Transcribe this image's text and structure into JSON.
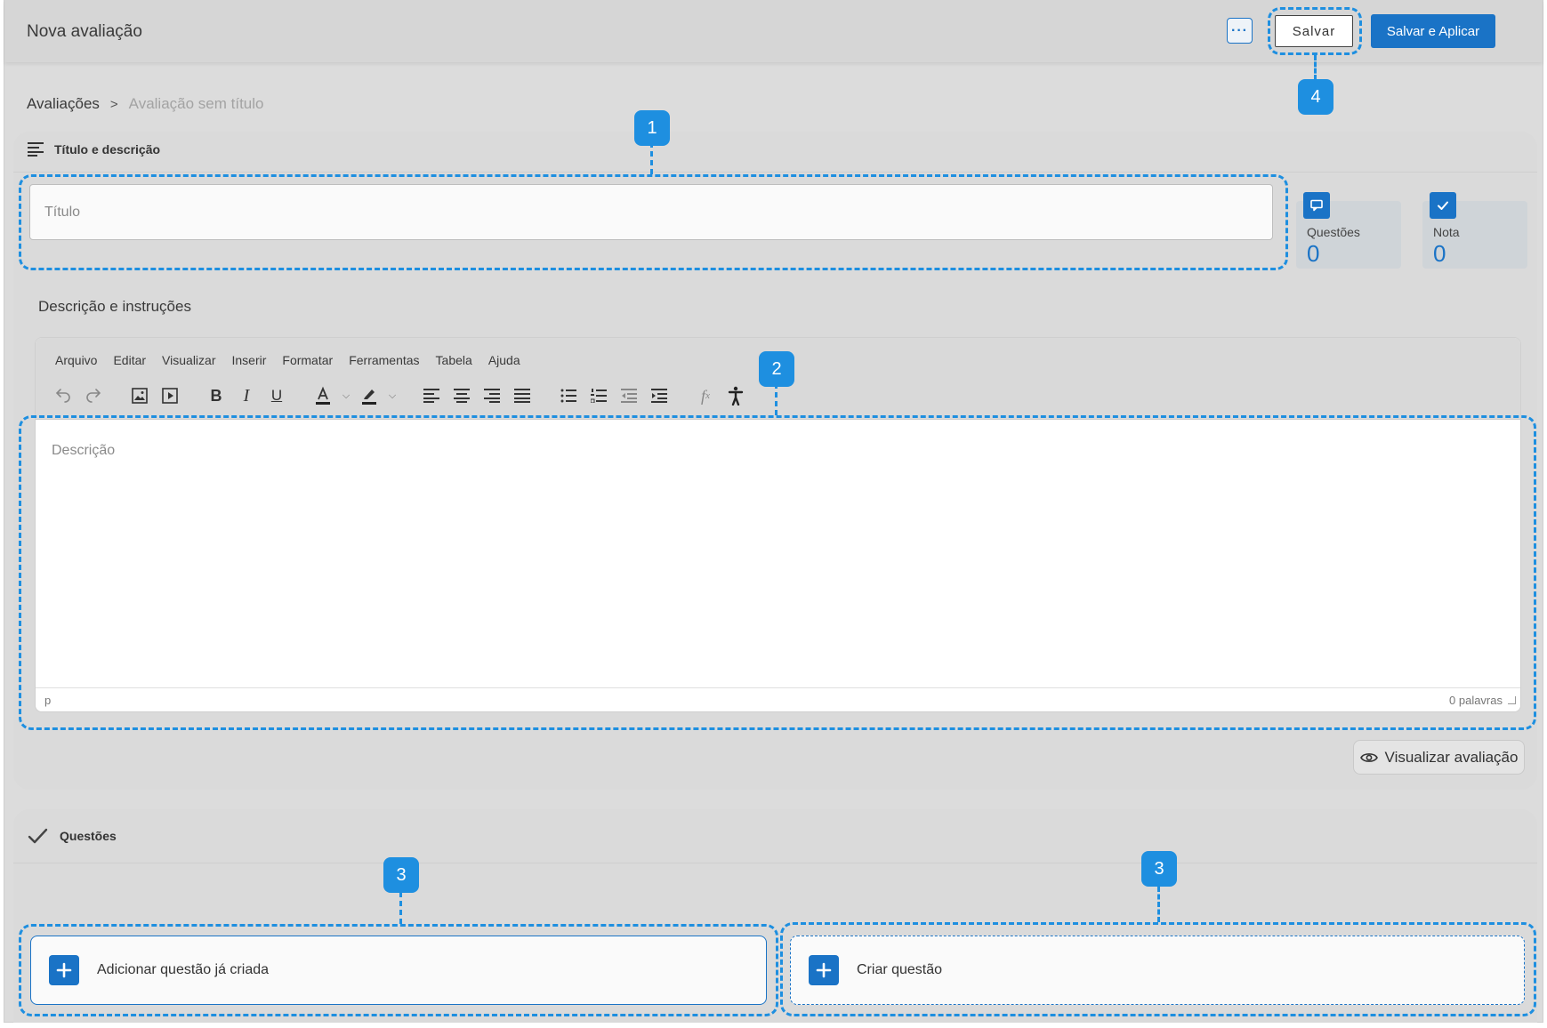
{
  "header": {
    "title": "Nova avaliação",
    "more_label": "···",
    "save_label": "Salvar",
    "save_apply_label": "Salvar e Aplicar"
  },
  "breadcrumb": {
    "root": "Avaliações",
    "separator": ">",
    "current": "Avaliação sem título"
  },
  "title_section": {
    "heading": "Título e descrição",
    "title_placeholder": "Título",
    "title_value": ""
  },
  "stats": {
    "questions": {
      "label": "Questões",
      "value": "0"
    },
    "grade": {
      "label": "Nota",
      "value": "0"
    }
  },
  "description": {
    "label": "Descrição e instruções",
    "placeholder": "Descrição",
    "menu": [
      "Arquivo",
      "Editar",
      "Visualizar",
      "Inserir",
      "Formatar",
      "Ferramentas",
      "Tabela",
      "Ajuda"
    ],
    "status_path": "p",
    "word_count": "0 palavras"
  },
  "toolbar_icons": [
    "undo-icon",
    "redo-icon",
    "image-icon",
    "video-icon",
    "bold-icon",
    "italic-icon",
    "underline-icon",
    "text-color-icon",
    "highlight-icon",
    "align-left-icon",
    "align-center-icon",
    "align-right-icon",
    "align-justify-icon",
    "bullet-list-icon",
    "numbered-list-icon",
    "outdent-icon",
    "indent-icon",
    "formula-icon",
    "accessibility-icon"
  ],
  "preview_label": "Visualizar avaliação",
  "questions_section": {
    "heading": "Questões",
    "add_existing_label": "Adicionar questão já criada",
    "create_label": "Criar questão"
  },
  "annotations": {
    "badge1": "1",
    "badge2": "2",
    "badge3a": "3",
    "badge3b": "3",
    "badge4": "4"
  },
  "colors": {
    "accent": "#1a73c6",
    "annotation": "#1e8fe0",
    "background": "#dcdcdc"
  }
}
